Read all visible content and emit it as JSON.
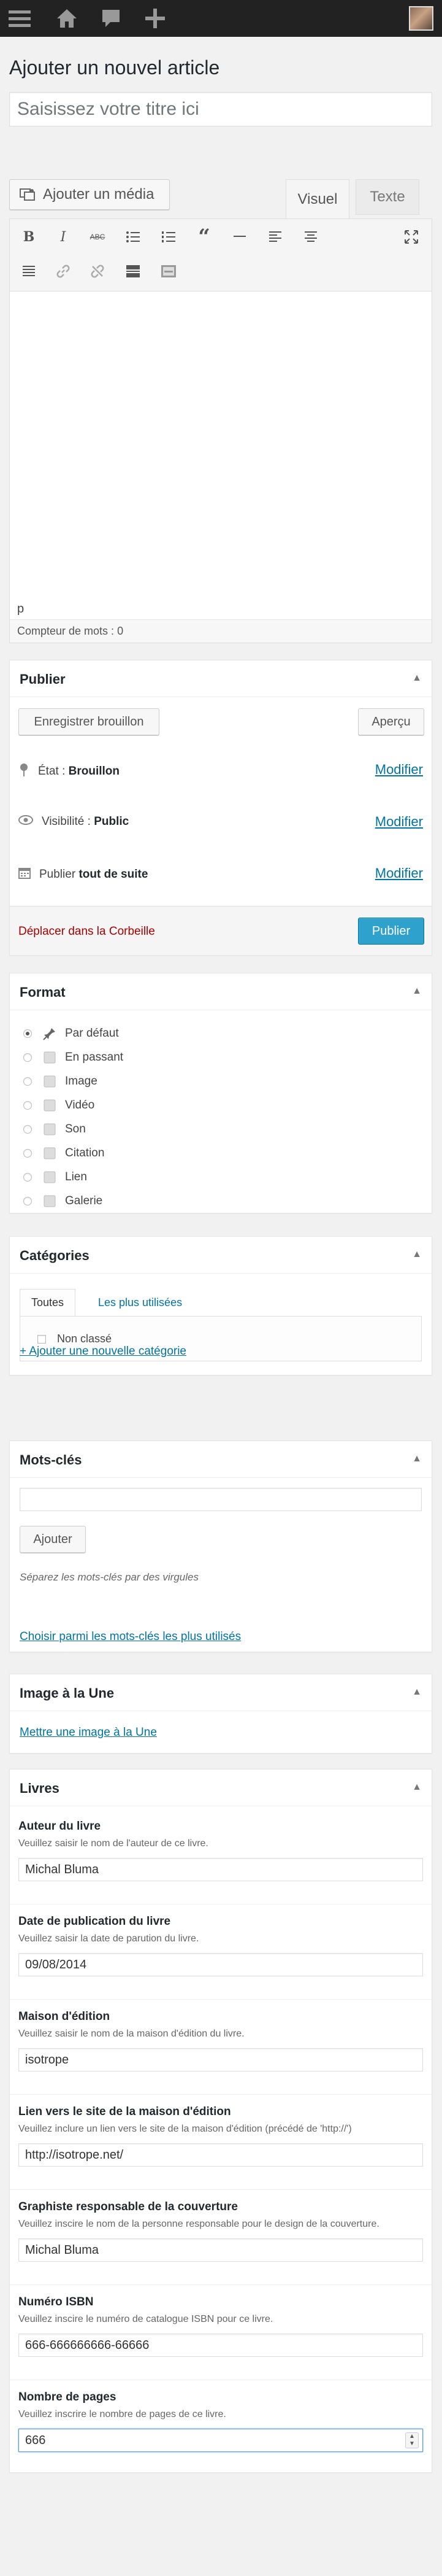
{
  "admin_bar": {
    "icons": [
      "menu-icon",
      "home-icon",
      "comment-icon",
      "plus-icon"
    ]
  },
  "page_title": "Ajouter un nouvel article",
  "title_placeholder": "Saisissez votre titre ici",
  "editor": {
    "add_media_label": "Ajouter un média",
    "tab_visual": "Visuel",
    "tab_text": "Texte",
    "toolbar_row1": [
      "bold-icon",
      "italic-icon",
      "strikethrough-icon",
      "bullet-list-icon",
      "numbered-list-icon",
      "blockquote-icon",
      "horizontal-line-icon",
      "align-left-icon",
      "align-center-icon",
      "fullscreen-icon"
    ],
    "toolbar_row2": [
      "toolbar-toggle-icon",
      "link-icon",
      "unlink-icon",
      "read-more-icon",
      "keyboard-icon"
    ],
    "toolbar_glyphs": {
      "bold": "B",
      "italic": "I",
      "strike": "ABC"
    },
    "path": "p",
    "word_count": "Compteur de mots : 0"
  },
  "publish": {
    "title": "Publier",
    "save_draft": "Enregistrer brouillon",
    "preview": "Aperçu",
    "status_label": "État :",
    "status_value": "Brouillon",
    "visibility_label": "Visibilité :",
    "visibility_value": "Public",
    "publish_label": "Publier",
    "publish_value": "tout de suite",
    "edit_link": "Modifier",
    "trash": "Déplacer dans la Corbeille",
    "publish_button": "Publier"
  },
  "format": {
    "title": "Format",
    "options": [
      {
        "label": "Par défaut",
        "icon": "pin-icon",
        "checked": true
      },
      {
        "label": "En passant",
        "icon": "aside-icon",
        "checked": false
      },
      {
        "label": "Image",
        "icon": "image-icon",
        "checked": false
      },
      {
        "label": "Vidéo",
        "icon": "video-icon",
        "checked": false
      },
      {
        "label": "Son",
        "icon": "audio-icon",
        "checked": false
      },
      {
        "label": "Citation",
        "icon": "quote-icon",
        "checked": false
      },
      {
        "label": "Lien",
        "icon": "link-icon",
        "checked": false
      },
      {
        "label": "Galerie",
        "icon": "gallery-icon",
        "checked": false
      }
    ]
  },
  "categories": {
    "title": "Catégories",
    "tab_all": "Toutes",
    "tab_popular": "Les plus utilisées",
    "items": [
      "Non classé"
    ],
    "add_link": "+ Ajouter une nouvelle catégorie"
  },
  "tags": {
    "title": "Mots-clés",
    "input_value": "",
    "add_button": "Ajouter",
    "hint": "Séparez les mots-clés par des virgules",
    "choose_link": "Choisir parmi les mots-clés les plus utilisés"
  },
  "featured_image": {
    "title": "Image à la Une",
    "link": "Mettre une image à la Une"
  },
  "books": {
    "title": "Livres",
    "fields": [
      {
        "label": "Auteur du livre",
        "desc": "Veuillez saisir le nom de l'auteur de ce livre.",
        "value": "Michal Bluma"
      },
      {
        "label": "Date de publication du livre",
        "desc": "Veuillez saisir la date de parution du livre.",
        "value": "09/08/2014"
      },
      {
        "label": "Maison d'édition",
        "desc": "Veuillez saisir le nom de la maison d'édition du livre.",
        "value": "isotrope"
      },
      {
        "label": "Lien vers le site de la maison d'édition",
        "desc": "Veuillez inclure un lien vers le site de la maison d'édition (précédé de 'http://')",
        "value": "http://isotrope.net/"
      },
      {
        "label": "Graphiste responsable de la couverture",
        "desc": "Veuillez inscire le nom de la personne responsable pour le design de la couverture.",
        "value": "Michal Bluma"
      },
      {
        "label": "Numéro ISBN",
        "desc": "Veuillez inscire le numéro de catalogue ISBN pour ce livre.",
        "value": "666-666666666-66666"
      },
      {
        "label": "Nombre de pages",
        "desc": "Veuillez inscrire le nombre de pages de ce livre.",
        "value": "666"
      }
    ]
  },
  "colors": {
    "accent": "#2ea2cc",
    "link": "#0074a2",
    "danger": "#a00",
    "admin_bar": "#222"
  }
}
